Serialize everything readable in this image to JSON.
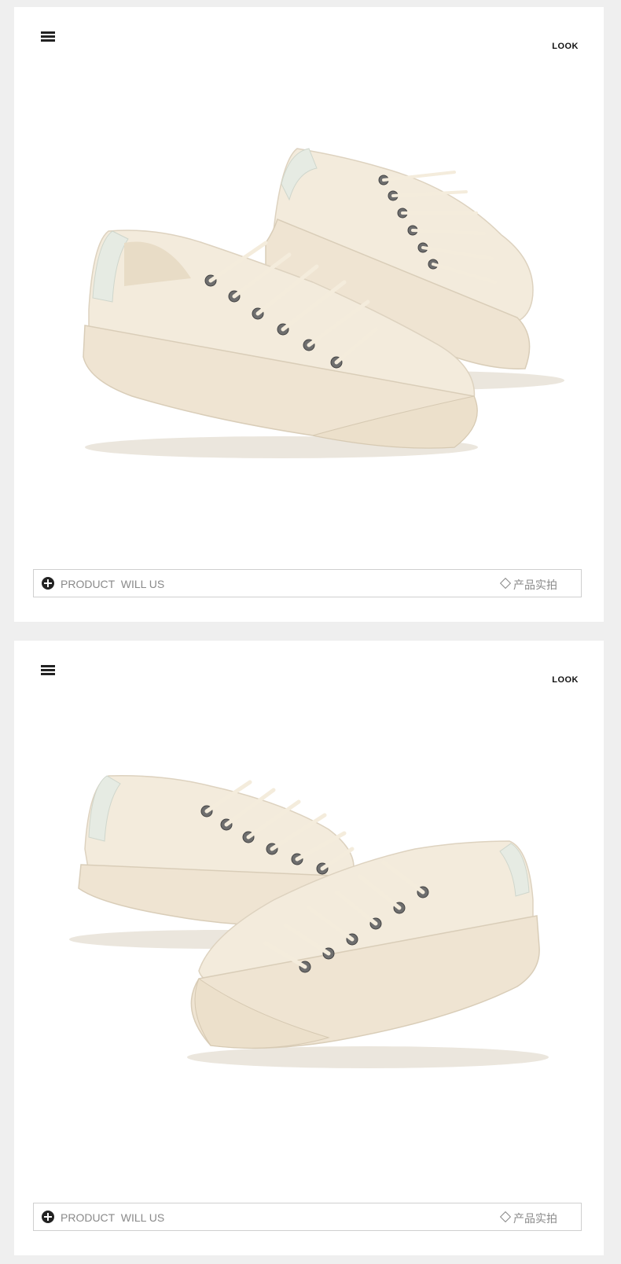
{
  "cards": [
    {
      "look_label": "LOOK",
      "menu_icon": "hamburger-menu-icon",
      "image_subject": "pair of cream canvas low-top sneakers",
      "footer": {
        "plus_icon": "plus-circle-icon",
        "left_text": "PRODUCT  WILL US",
        "diamond_icon": "diamond-outline-icon",
        "right_text": "产品实拍"
      }
    },
    {
      "look_label": "LOOK",
      "menu_icon": "hamburger-menu-icon",
      "image_subject": "pair of cream canvas low-top sneakers",
      "footer": {
        "plus_icon": "plus-circle-icon",
        "left_text": "PRODUCT  WILL US",
        "diamond_icon": "diamond-outline-icon",
        "right_text": "产品实拍"
      }
    }
  ],
  "colors": {
    "page_background": "#efefef",
    "card_background": "#ffffff",
    "shoe_canvas": "#f3ebdc",
    "shoe_sole": "#efe4d2",
    "heel_tab": "#e6ebe3",
    "eyelet": "#6e6e6e",
    "footer_text": "#8a8a8a"
  }
}
